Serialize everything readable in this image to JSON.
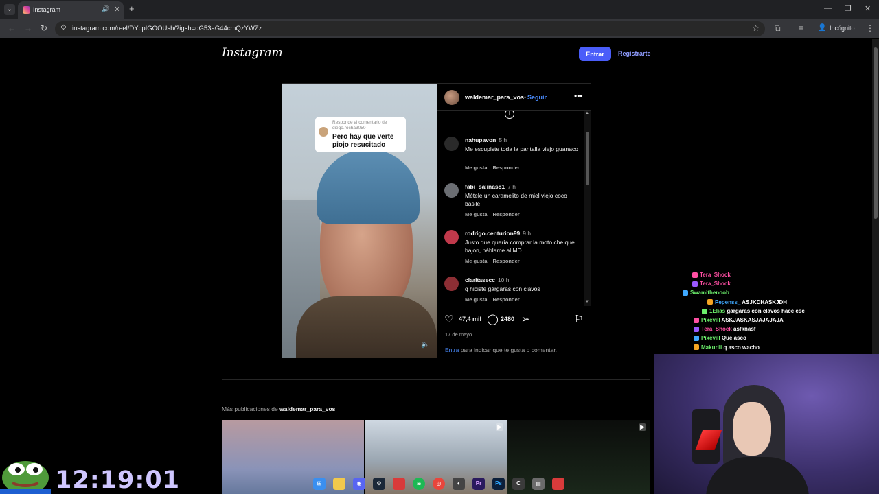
{
  "browser": {
    "tab_title": "Instagram",
    "url": "instagram.com/reel/DYcpIGOOUsh/?igsh=dG53aG44cmQzYWZz",
    "incognito_label": "Incógnito"
  },
  "header": {
    "logo": "Instagram",
    "login_button": "Entrar",
    "register_link": "Registrarte"
  },
  "post": {
    "video_caption_small": "Responde al comentario de diego.rocha3050",
    "video_caption": "Pero hay que verte piojo resucitado",
    "owner": "waldemar_para_vos",
    "separator": "•",
    "follow": "Seguir",
    "comments": [
      {
        "user": "nahupavon",
        "time": "5 h",
        "text": "Me escupiste toda la pantalla viejo guanaco",
        "like": "Me gusta",
        "reply": "Responder",
        "avatar_color": "#2a2a2a"
      },
      {
        "user": "fabi_salinas81",
        "time": "7 h",
        "text": "Métele un caramelito de miel viejo coco basile",
        "like": "Me gusta",
        "reply": "Responder",
        "avatar_color": "#6b6e73"
      },
      {
        "user": "rodrigo.centurion99",
        "time": "9 h",
        "text": "Justo que quería comprar la moto che que bajon, háblame al MD",
        "like": "Me gusta",
        "reply": "Responder",
        "avatar_color": "#c0394b"
      },
      {
        "user": "claritasecc",
        "time": "10 h",
        "text": "q hiciste gárgaras con clavos",
        "like": "Me gusta",
        "reply": "Responder",
        "avatar_color": "#8c2e34"
      }
    ],
    "likes": "47,4 mil",
    "comment_count": "2480",
    "date": "17 de mayo",
    "login_prefix": "Entra",
    "login_suffix": "para indicar que te gusta o comentar."
  },
  "more_posts": {
    "label": "Más publicaciones de",
    "user": "waldemar_para_vos"
  },
  "chat": [
    {
      "user": "Tera_Shock",
      "msg": "",
      "color": "#ff4fa3"
    },
    {
      "user": "Tera_Shock",
      "msg": "",
      "color": "#ff4fa3"
    },
    {
      "user": "Swamithenoob",
      "msg": "",
      "color": "#6cf06c"
    },
    {
      "user": "Pepenss_",
      "msg": "ASJKDHASKJDH",
      "color": "#3fa9ff"
    },
    {
      "user": "1Elias",
      "msg": "gargaras con clavos hace ese",
      "color": "#6cf06c"
    },
    {
      "user": "Pixevill",
      "msg": "ASKJASKASJAJAJAJA",
      "color": "#6cf06c"
    },
    {
      "user": "Tera_Shock",
      "msg": "asfkñasf",
      "color": "#ff4fa3"
    },
    {
      "user": "Pixevill",
      "msg": "Que asco",
      "color": "#6cf06c"
    },
    {
      "user": "Makurili",
      "msg": "q asco wacho",
      "color": "#6cf06c"
    }
  ],
  "clock": "12:19:01",
  "colors": {
    "accent": "#4a5df9",
    "link": "#4a8cff",
    "clock": "#cfc6ff"
  },
  "icons": {
    "like": "heart-icon",
    "comment": "comment-icon",
    "share": "share-icon",
    "save": "bookmark-icon",
    "volume": "speaker-icon"
  }
}
